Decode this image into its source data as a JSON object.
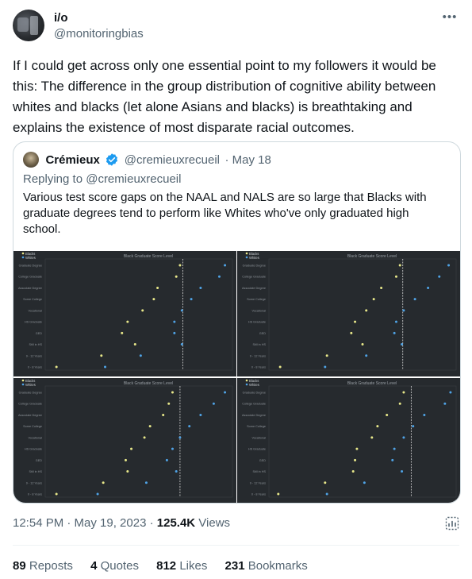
{
  "author": {
    "name": "i/o",
    "handle": "@monitoringbias"
  },
  "tweet": {
    "text": "If I could get across only one essential point to my followers it would be this: The difference in the group distribution of cognitive ability between whites and blacks (let alone Asians and blacks) is breathtaking and explains the existence of most disparate racial outcomes."
  },
  "quote": {
    "name": "Crémieux",
    "handle": "@cremieuxrecueil",
    "date": "· May 18",
    "reply": "Replying to @cremieuxrecueil",
    "text": "Various test score gaps on the NAAL and NALS are so large that Blacks with graduate degrees tend to perform like Whites who've only graduated high school."
  },
  "meta": {
    "time": "12:54 PM · May 19, 2023 · ",
    "views_count": "125.4K",
    "views_label": " Views"
  },
  "stats": {
    "reposts_count": "89",
    "reposts_label": "Reposts",
    "quotes_count": "4",
    "quotes_label": "Quotes",
    "likes_count": "812",
    "likes_label": "Likes",
    "bookmarks_count": "231",
    "bookmarks_label": "Bookmarks"
  },
  "colors": {
    "panel_bg": "#262a2e",
    "blacks": "#e8e88a",
    "whites": "#4fa3e6",
    "ref_line": "#d9d9d9"
  },
  "chart_data": [
    {
      "type": "scatter",
      "title": "Black Graduate Score Level",
      "legend": [
        "Blacks",
        "Whites"
      ],
      "categories": [
        "Graduate Degree",
        "College Graduate",
        "Associate Degree",
        "Some College",
        "Vocational",
        "HS Graduate",
        "GED",
        "Still in HS",
        "9 - 12 Years",
        "0 - 8 Years"
      ],
      "series": [
        {
          "name": "Blacks",
          "values": [
            0.72,
            0.7,
            0.6,
            0.58,
            0.52,
            0.44,
            0.41,
            0.48,
            0.3,
            0.06
          ]
        },
        {
          "name": "Whites",
          "values": [
            0.96,
            0.93,
            0.83,
            0.78,
            0.73,
            0.69,
            0.69,
            0.73,
            0.51,
            0.32
          ]
        }
      ],
      "ref_x": 0.735
    },
    {
      "type": "scatter",
      "title": "Black Graduate Score Level",
      "legend": [
        "Blacks",
        "Whites"
      ],
      "categories": [
        "Graduate Degree",
        "College Graduate",
        "Associate Degree",
        "Some College",
        "Vocational",
        "HS Graduate",
        "GED",
        "Still in HS",
        "9 - 12 Years",
        "0 - 8 Years"
      ],
      "series": [
        {
          "name": "Blacks",
          "values": [
            0.7,
            0.68,
            0.6,
            0.56,
            0.52,
            0.46,
            0.44,
            0.5,
            0.31,
            0.06
          ]
        },
        {
          "name": "Whites",
          "values": [
            0.96,
            0.91,
            0.85,
            0.78,
            0.72,
            0.68,
            0.67,
            0.71,
            0.52,
            0.3
          ]
        }
      ],
      "ref_x": 0.715
    },
    {
      "type": "scatter",
      "title": "Black Graduate Score Level",
      "legend": [
        "Blacks",
        "Whites"
      ],
      "categories": [
        "Graduate Degree",
        "College Graduate",
        "Associate Degree",
        "Some College",
        "Vocational",
        "HS Graduate",
        "GED",
        "Still in HS",
        "9 - 12 Years",
        "0 - 8 Years"
      ],
      "series": [
        {
          "name": "Blacks",
          "values": [
            0.68,
            0.66,
            0.63,
            0.56,
            0.53,
            0.46,
            0.43,
            0.44,
            0.31,
            0.06
          ]
        },
        {
          "name": "Whites",
          "values": [
            0.96,
            0.9,
            0.83,
            0.77,
            0.72,
            0.68,
            0.65,
            0.7,
            0.54,
            0.28
          ]
        }
      ],
      "ref_x": 0.72
    },
    {
      "type": "scatter",
      "title": "Black Graduate Score Level",
      "legend": [
        "Blacks",
        "Whites"
      ],
      "categories": [
        "Graduate Degree",
        "College Graduate",
        "Associate Degree",
        "Some College",
        "Vocational",
        "HS Graduate",
        "GED",
        "Still in HS",
        "9 - 12 Years",
        "0 - 8 Years"
      ],
      "series": [
        {
          "name": "Blacks",
          "values": [
            0.72,
            0.7,
            0.63,
            0.58,
            0.55,
            0.47,
            0.46,
            0.45,
            0.3,
            0.05
          ]
        },
        {
          "name": "Whites",
          "values": [
            0.97,
            0.94,
            0.83,
            0.77,
            0.72,
            0.67,
            0.66,
            0.71,
            0.51,
            0.31
          ]
        }
      ],
      "ref_x": 0.76
    }
  ]
}
